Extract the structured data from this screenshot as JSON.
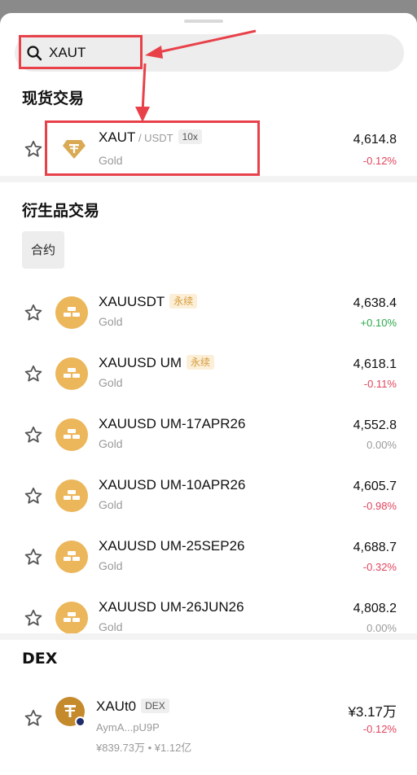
{
  "search": {
    "value": "XAUT"
  },
  "spot": {
    "title": "现货交易",
    "item": {
      "symbol": "XAUT",
      "quote": " / USDT",
      "leverage": "10x",
      "sub": "Gold",
      "price": "4,614.8",
      "change": "-0.12%"
    }
  },
  "derivatives": {
    "title": "衍生品交易",
    "filter_chip": "合约",
    "items": [
      {
        "symbol": "XAUUSDT",
        "tag": "永续",
        "sub": "Gold",
        "price": "4,638.4",
        "change": "+0.10%",
        "trend": "pos"
      },
      {
        "symbol": "XAUUSD UM",
        "tag": "永续",
        "sub": "Gold",
        "price": "4,618.1",
        "change": "-0.11%",
        "trend": "neg"
      },
      {
        "symbol": "XAUUSD UM-17APR26",
        "tag": "",
        "sub": "Gold",
        "price": "4,552.8",
        "change": "0.00%",
        "trend": "flat"
      },
      {
        "symbol": "XAUUSD UM-10APR26",
        "tag": "",
        "sub": "Gold",
        "price": "4,605.7",
        "change": "-0.98%",
        "trend": "neg"
      },
      {
        "symbol": "XAUUSD UM-25SEP26",
        "tag": "",
        "sub": "Gold",
        "price": "4,688.7",
        "change": "-0.32%",
        "trend": "neg"
      },
      {
        "symbol": "XAUUSD UM-26JUN26",
        "tag": "",
        "sub": "Gold",
        "price": "4,808.2",
        "change": "0.00%",
        "trend": "flat"
      }
    ]
  },
  "dex": {
    "title": "DEX",
    "item": {
      "symbol": "XAUt0",
      "tag": "DEX",
      "address": "AymA...pU9P",
      "stats": "¥839.73万 • ¥1.12亿",
      "price": "¥3.17万",
      "change": "-0.12%"
    }
  },
  "colors": {
    "negative": "#e0455e",
    "positive": "#2ba84a",
    "highlight_box": "#e8414a",
    "coin_gold": "#ecb65a"
  },
  "icons": {
    "search": "search-icon",
    "favorite": "star-outline-icon",
    "tether_gold": "tether-gold-icon",
    "gold_bar": "gold-bars-icon"
  }
}
